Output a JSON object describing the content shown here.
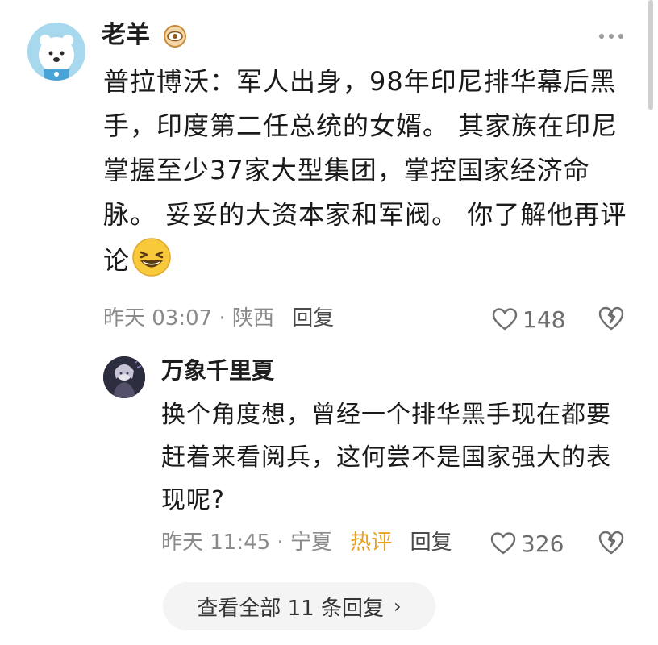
{
  "comment": {
    "author": "老羊",
    "badge_icon": "eye-badge-icon",
    "text": "普拉博沃：军人出身，98年印尼排华幕后黑手，印度第二任总统的女婿。 其家族在印尼掌握至少37家大型集团，掌控国家经济命脉。 妥妥的大资本家和军阀。 你了解他再评论",
    "emoji": "grinning-squint-emoji",
    "time": "昨天 03:07",
    "separator": "·",
    "location": "陕西",
    "reply_label": "回复",
    "likes": "148"
  },
  "reply": {
    "author": "万象千里夏",
    "text": "换个角度想，曾经一个排华黑手现在都要赶着来看阅兵，这何尝不是国家强大的表现呢?",
    "time": "昨天 11:45",
    "separator": "·",
    "location": "宁夏",
    "hot_label": "热评",
    "reply_label": "回复",
    "likes": "326"
  },
  "view_all": {
    "label": "查看全部 11 条回复",
    "chevron": "›"
  },
  "colors": {
    "hot": "#e8a020",
    "meta": "#8a8a8a",
    "pill_bg": "#f4f4f4"
  }
}
